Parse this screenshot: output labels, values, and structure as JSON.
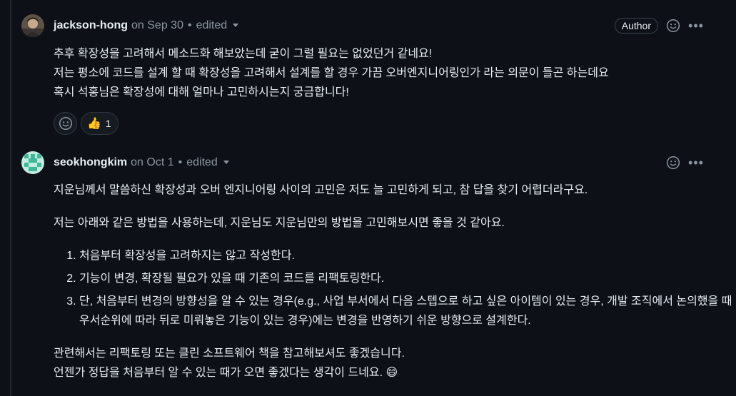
{
  "comments": [
    {
      "author": "jackson-hong",
      "date": "on Sep 30",
      "edited": "edited",
      "role_badge": "Author",
      "body": [
        "추후 확장성을 고려해서 메소드화 해보았는데 굳이 그럴 필요는 없었던거 같네요!",
        "저는 평소에 코드를 설계 할 때 확장성을 고려해서 설계를 할 경우 가끔 오버엔지니어링인가 라는 의문이 들곤 하는데요",
        "혹시 석홍님은 확장성에 대해 얼마나 고민하시는지 궁금합니다!"
      ],
      "reactions": [
        {
          "emoji": "👍",
          "count": "1"
        }
      ]
    },
    {
      "author": "seokhongkim",
      "date": "on Oct 1",
      "edited": "edited",
      "para1": "지운님께서 말씀하신 확장성과 오버 엔지니어링 사이의 고민은 저도 늘 고민하게 되고, 참 답을 찾기 어렵더라구요.",
      "para2": "저는 아래와 같은 방법을 사용하는데, 지운님도 지운님만의 방법을 고민해보시면 좋을 것 같아요.",
      "list": [
        "처음부터 확장성을 고려하지는 않고 작성한다.",
        "기능이 변경, 확장될 필요가 있을 때 기존의 코드를 리팩토링한다.",
        "단, 처음부터 변경의 방향성을 알 수 있는 경우(e.g., 사업 부서에서 다음 스텝으로 하고 싶은 아이템이 있는 경우, 개발 조직에서 논의했을 때 우서순위에 따라 뒤로 미뤄놓은 기능이 있는 경우)에는 변경을 반영하기 쉬운 방향으로 설계한다."
      ],
      "closing1": "관련해서는 리팩토링 또는 클린 소프트웨어 책을 참고해보셔도 좋겠습니다.",
      "closing2": "언젠가 정답을 처음부터 알 수 있는 때가 오면 좋겠다는 생각이 드네요.",
      "closing2_emoji": "😄"
    }
  ],
  "icons": {
    "emoji_picker": "smiley-icon",
    "more_options": "kebab-icon",
    "edit_history": "caret-down-icon"
  },
  "colors": {
    "background": "#0d1117",
    "text": "#e6edf3",
    "muted": "#8d96a0",
    "border": "#30363d"
  }
}
